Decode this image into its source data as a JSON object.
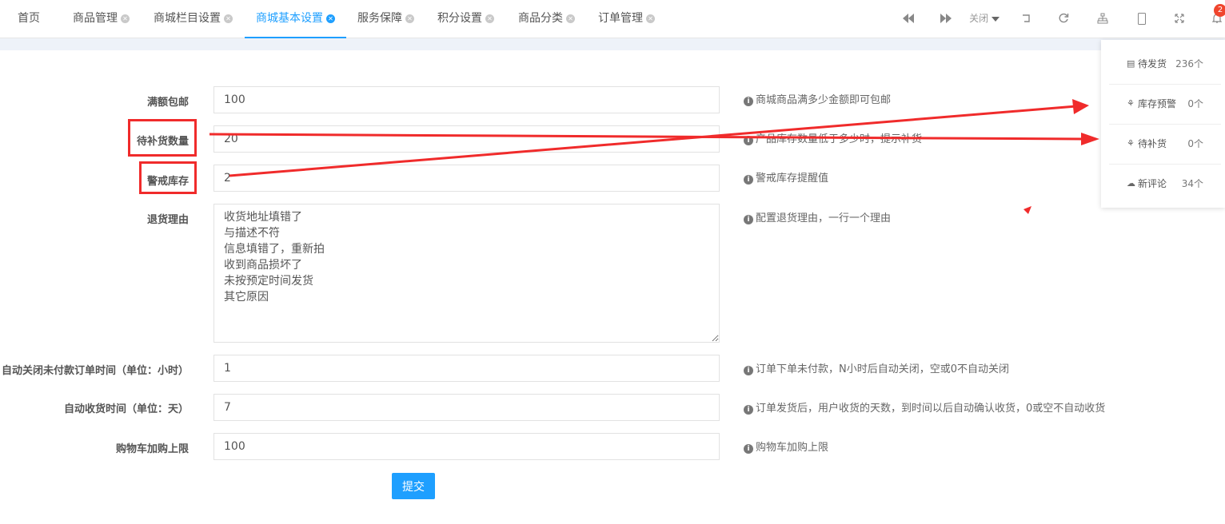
{
  "tabs": [
    {
      "label": "首页",
      "closable": false,
      "active": false
    },
    {
      "label": "商品管理",
      "closable": true,
      "active": false
    },
    {
      "label": "商城栏目设置",
      "closable": true,
      "active": false
    },
    {
      "label": "商城基本设置",
      "closable": true,
      "active": true
    },
    {
      "label": "服务保障",
      "closable": true,
      "active": false
    },
    {
      "label": "积分设置",
      "closable": true,
      "active": false
    },
    {
      "label": "商品分类",
      "closable": true,
      "active": false
    },
    {
      "label": "订单管理",
      "closable": true,
      "active": false
    }
  ],
  "toolbar": {
    "close_label": "关闭",
    "notification_count": "2",
    "icons": [
      "rewind-icon",
      "forward-icon",
      "close-menu-icon",
      "back-icon",
      "refresh-icon",
      "sitemap-icon",
      "mobile-icon",
      "fullscreen-icon",
      "bell-icon"
    ]
  },
  "form": {
    "free_shipping": {
      "label": "满额包邮",
      "value": "100",
      "hint": "商城商品满多少金额即可包邮"
    },
    "restock_qty": {
      "label": "待补货数量",
      "value": "20",
      "hint": "产品库存数量低于多少时，提示补货"
    },
    "stock_alert": {
      "label": "警戒库存",
      "value": "2",
      "hint": "警戒库存提醒值"
    },
    "return_reasons": {
      "label": "退货理由",
      "value": "收货地址填错了\n与描述不符\n信息填错了，重新拍\n收到商品损坏了\n未按预定时间发货\n其它原因",
      "hint": "配置退货理由，一行一个理由"
    },
    "auto_close": {
      "label": "自动关闭未付款订单时间（单位：小时）",
      "value": "1",
      "hint": "订单下单未付款，N小时后自动关闭，空或0不自动关闭"
    },
    "auto_receive": {
      "label": "自动收货时间（单位：天）",
      "value": "7",
      "hint": "订单发货后，用户收货的天数，到时间以后自动确认收货，0或空不自动收货"
    },
    "cart_limit": {
      "label": "购物车加购上限",
      "value": "100",
      "hint": "购物车加购上限"
    },
    "submit_label": "提交"
  },
  "notifications": [
    {
      "label": "待发货",
      "count": "236个"
    },
    {
      "label": "库存预警",
      "count": "0个"
    },
    {
      "label": "待补货",
      "count": "0个"
    },
    {
      "label": "新评论",
      "count": "34个"
    }
  ],
  "colors": {
    "accent": "#1e9fff",
    "annotation": "#f02b2b",
    "badge": "#f0452d"
  }
}
